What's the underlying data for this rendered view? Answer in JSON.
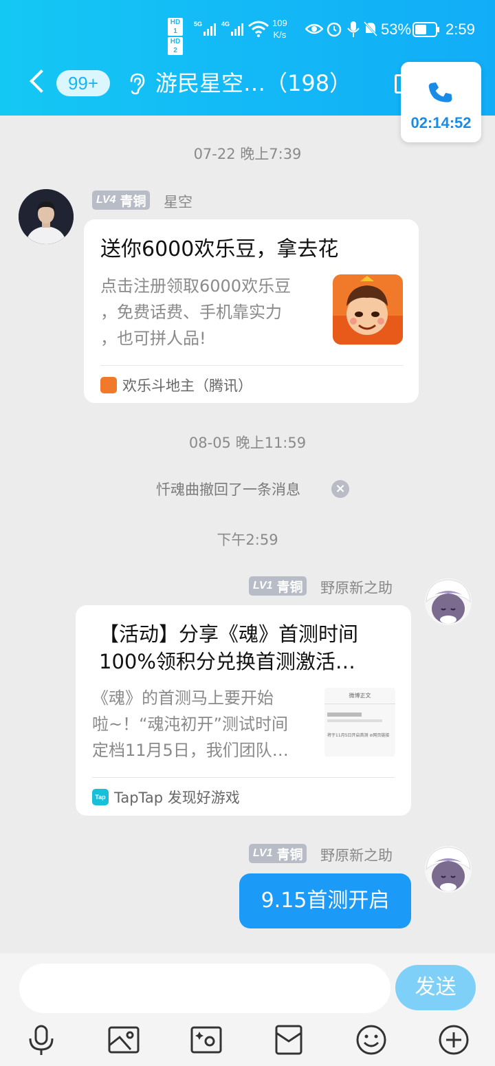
{
  "status_bar": {
    "hd1": "HD 1",
    "hd2": "HD 2",
    "net_speed_value": "109",
    "net_speed_unit": "K/s",
    "battery": "53%",
    "time": "2:59"
  },
  "header": {
    "back_icon": "chevron-left-icon",
    "unread_badge": "99+",
    "ear_icon": "ear-icon",
    "title": "游民星空…（198）"
  },
  "call": {
    "icon": "phone-icon",
    "duration": "02:14:52"
  },
  "messages": {
    "ts1": "07-22 晚上7:39",
    "msg1": {
      "level": "LV4",
      "rank": "青铜",
      "nickname": "星空",
      "card_title": "送你6000欢乐豆，拿去花",
      "card_desc_1": "点击注册领取6000欢乐豆",
      "card_desc_2": "，免费话费、手机靠实力",
      "card_desc_3": "，也可拼人品!",
      "source": "欢乐斗地主（腾讯）"
    },
    "ts2": "08-05 晚上11:59",
    "recall_text": "忏魂曲撤回了一条消息",
    "ts3": "下午2:59",
    "msg2": {
      "level": "LV1",
      "rank": "青铜",
      "nickname": "野原新之助",
      "card_title_1": "【活动】分享《魂》首测时间",
      "card_title_2": "100%领积分兑换首测激活…",
      "card_desc_1": "《魂》的首测马上要开始",
      "card_desc_2": "啦~！“魂沌初开”测试时间",
      "card_desc_3": "定档11月5日，我们团队…",
      "thumb_header": "微博正文",
      "thumb_line": "将于11月5日开启首测 ⊘网页链接",
      "source_icon_text": "Tap",
      "source": "TapTap 发现好游戏"
    },
    "msg3": {
      "level": "LV1",
      "rank": "青铜",
      "nickname": "野原新之助",
      "text": "9.15首测开启"
    }
  },
  "composer": {
    "input_value": "",
    "send_label": "发送"
  },
  "toolbar": [
    "microphone-icon",
    "image-icon",
    "camera-icon",
    "red-packet-icon",
    "emoji-icon",
    "plus-icon"
  ],
  "colors": {
    "header_start": "#14c8f4",
    "header_end": "#12adf7",
    "bubble": "#1b9af7",
    "send_button": "#7fd0f8",
    "call_time": "#1a8ce8"
  }
}
